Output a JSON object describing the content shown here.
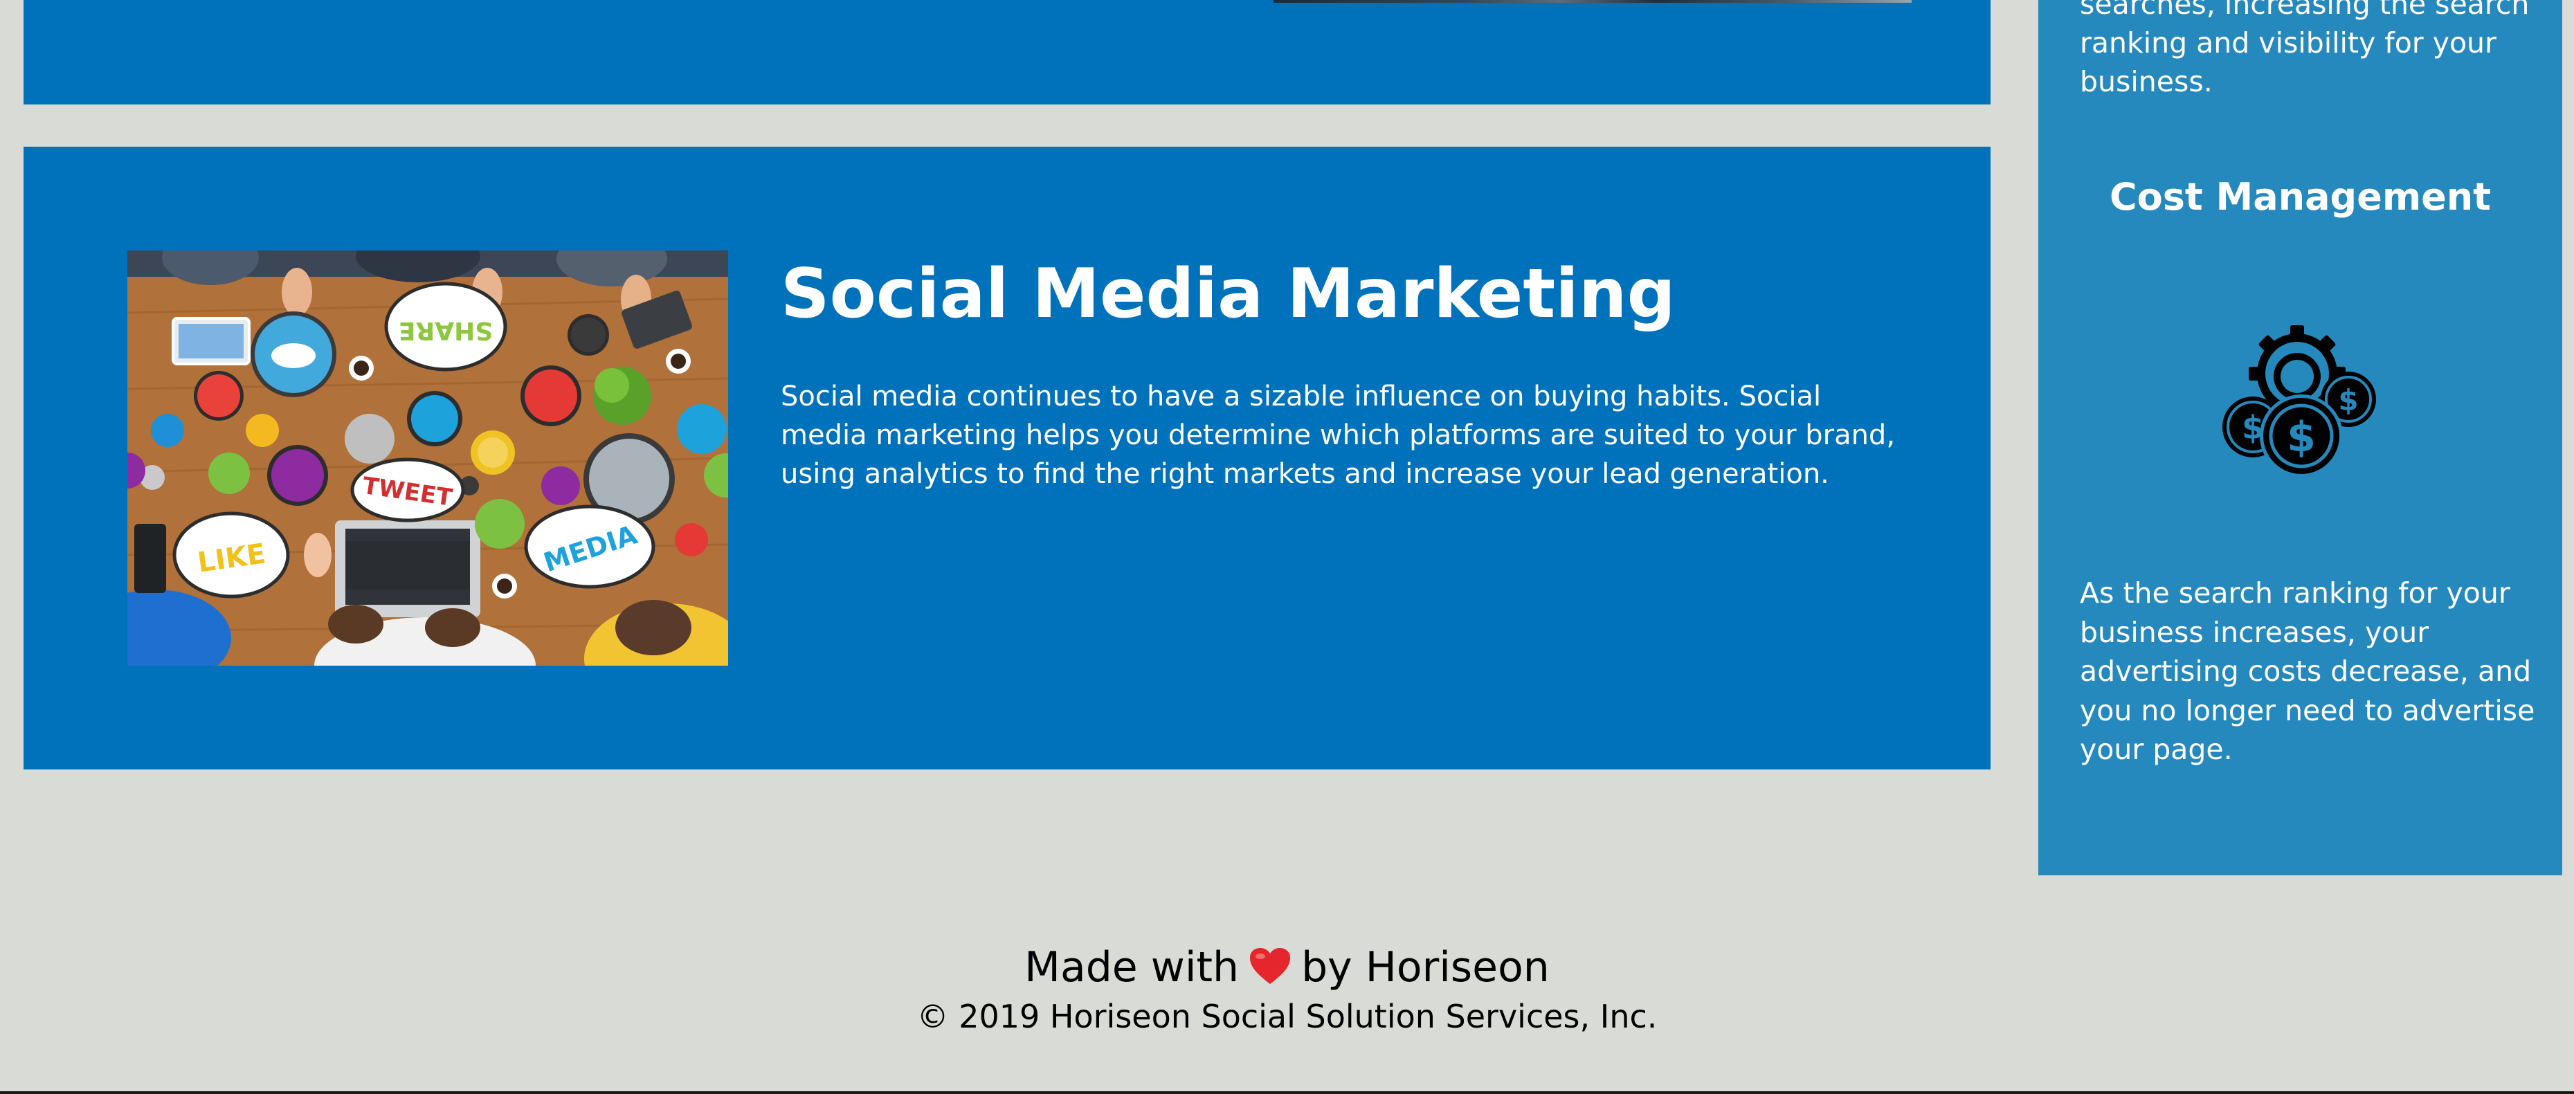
{
  "colors": {
    "page_background": "#d9dcd6",
    "panel_blue": "#0072bb",
    "benefits_blue": "#2589bd",
    "text_white": "#ffffff",
    "footer_text": "#000000",
    "heart_red": "#e5262c"
  },
  "content": {
    "social_media": {
      "title": "Social Media Marketing",
      "text": "Social media continues to have a sizable influence on buying habits. Social media marketing helps you determine which platforms are suited to your brand, using analytics to find the right markets and increase your lead generation.",
      "image_labels": {
        "share": "SHARE",
        "tweet": "TWEET",
        "like": "LIKE",
        "media": "MEDIA"
      }
    }
  },
  "benefits": {
    "brand_recognition_tail": "searches, increasing the search ranking and visibility for your business.",
    "cost_management": {
      "heading": "Cost Management",
      "icon": "cost-management-icon",
      "text": "As the search ranking for your business increases, your advertising costs decrease, and you no longer need to advertise your page."
    }
  },
  "footer": {
    "made_with_prefix": "Made with",
    "heart_icon": "heart-icon",
    "made_with_suffix": "by Horiseon",
    "copyright": "© 2019 Horiseon Social Solution Services, Inc."
  }
}
